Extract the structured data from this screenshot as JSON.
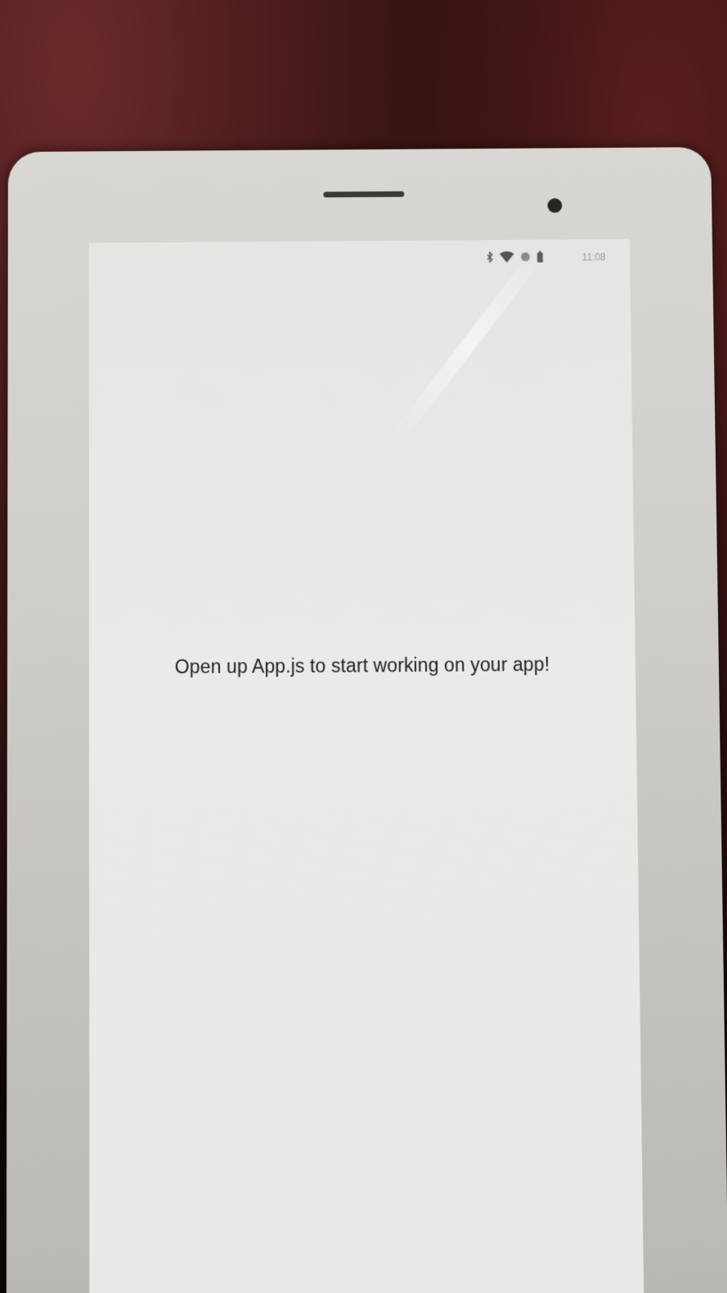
{
  "status_bar": {
    "time": "11:08",
    "icons": [
      "bluetooth-icon",
      "wifi-icon",
      "signal-icon",
      "battery-icon"
    ]
  },
  "app": {
    "message": "Open up App.js to start working on your app!"
  },
  "colors": {
    "screen_background": "#e9ebe9",
    "text": "#222222",
    "device_bezel": "#d4d2cd"
  }
}
